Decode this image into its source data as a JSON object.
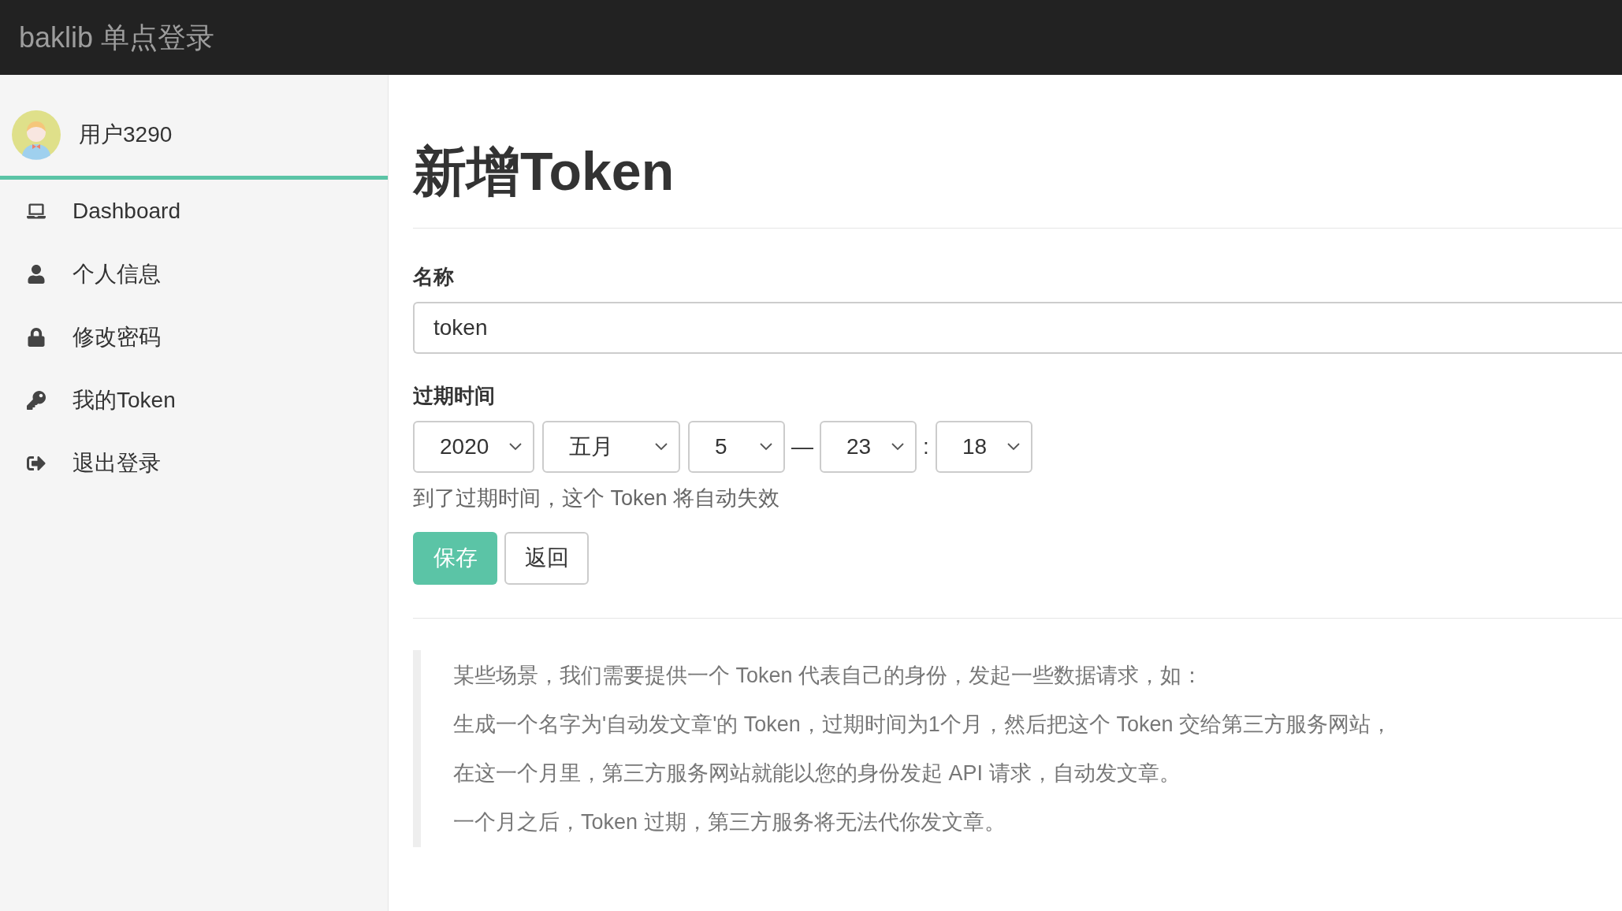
{
  "header": {
    "title": "baklib 单点登录"
  },
  "sidebar": {
    "user": {
      "name": "用户3290"
    },
    "items": [
      {
        "label": "Dashboard",
        "kind": "laptop"
      },
      {
        "label": "个人信息",
        "kind": "user"
      },
      {
        "label": "修改密码",
        "kind": "lock"
      },
      {
        "label": "我的Token",
        "kind": "key"
      },
      {
        "label": "退出登录",
        "kind": "logout"
      }
    ]
  },
  "page": {
    "title": "新增Token",
    "name_field": {
      "label": "名称",
      "value": "token"
    },
    "expiry": {
      "label": "过期时间",
      "year": "2020",
      "month": "五月",
      "day": "5",
      "date_time_separator": "—",
      "hour": "23",
      "time_separator": ":",
      "minute": "18",
      "help": "到了过期时间，这个 Token 将自动失效"
    },
    "buttons": [
      {
        "label": "保存",
        "kind": "primary"
      },
      {
        "label": "返回",
        "kind": "default"
      }
    ],
    "note": [
      "某些场景，我们需要提供一个 Token 代表自己的身份，发起一些数据请求，如：",
      "生成一个名字为'自动发文章'的 Token，过期时间为1个月，然后把这个 Token 交给第三方服务网站，",
      "在这一个月里，第三方服务网站就能以您的身份发起 API 请求，自动发文章。",
      "一个月之后，Token 过期，第三方服务将无法代你发文章。"
    ]
  }
}
